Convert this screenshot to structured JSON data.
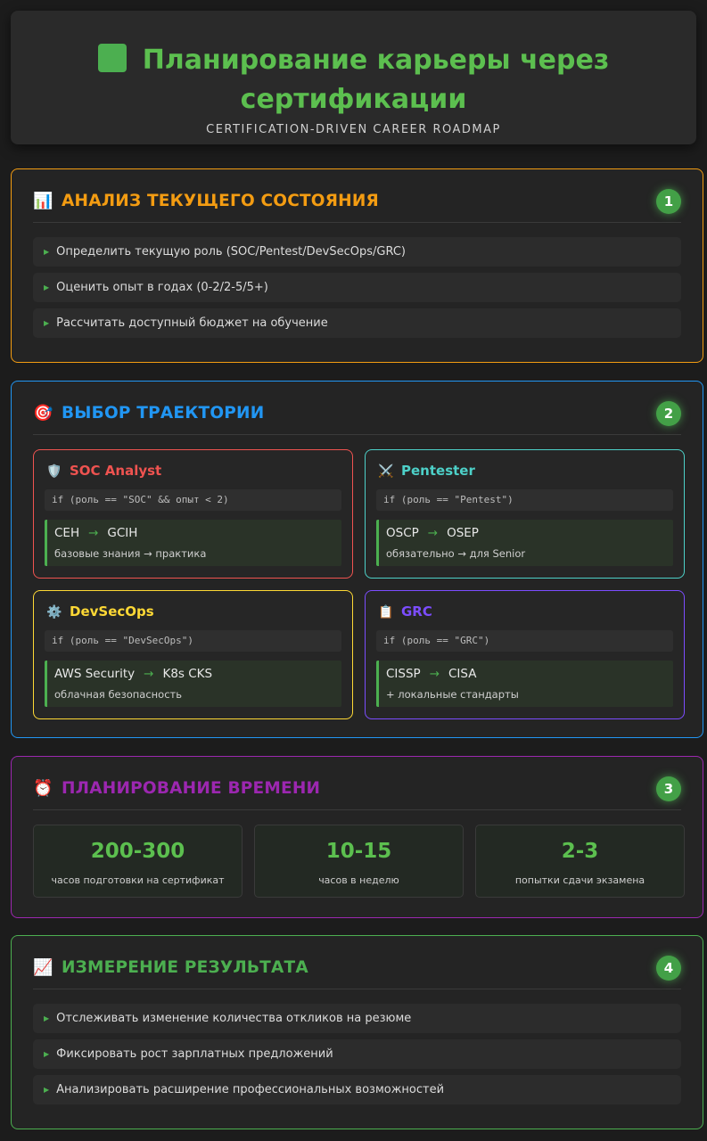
{
  "header": {
    "title_line1": "Планирование карьеры через",
    "title_line2": "сертификации",
    "subtitle": "CERTIFICATION-DRIVEN CAREER ROADMAP"
  },
  "colors": {
    "analysis": "#f39c12",
    "trajectory": "#2196f3",
    "time": "#9c27b0",
    "result": "#4caf50",
    "soc": "#ef5350",
    "pentester": "#4dd0c8",
    "devsecops": "#fdd835",
    "grc": "#7c4dff"
  },
  "sections": {
    "analysis": {
      "icon": "📊",
      "title": "АНАЛИЗ ТЕКУЩЕГО СОСТОЯНИЯ",
      "number": "1",
      "items": [
        "Определить текущую роль (SOC/Pentest/DevSecOps/GRC)",
        "Оценить опыт в годах (0-2/2-5/5+)",
        "Рассчитать доступный бюджет на обучение"
      ]
    },
    "trajectory": {
      "icon": "🎯",
      "title": "ВЫБОР ТРАЕКТОРИИ",
      "number": "2",
      "cards": [
        {
          "icon": "🛡️",
          "title": "SOC Analyst",
          "code": "if (роль == \"SOC\" && опыт < 2)",
          "from": "CEH",
          "to": "GCIH",
          "note": "базовые знания → практика"
        },
        {
          "icon": "⚔️",
          "title": "Pentester",
          "code": "if (роль == \"Pentest\")",
          "from": "OSCP",
          "to": "OSEP",
          "note": "обязательно → для Senior"
        },
        {
          "icon": "⚙️",
          "title": "DevSecOps",
          "code": "if (роль == \"DevSecOps\")",
          "from": "AWS Security",
          "to": "K8s CKS",
          "note": "облачная безопасность"
        },
        {
          "icon": "📋",
          "title": "GRC",
          "code": "if (роль == \"GRC\")",
          "from": "CISSP",
          "to": "CISA",
          "note": "+ локальные стандарты"
        }
      ]
    },
    "time": {
      "icon": "⏰",
      "title": "ПЛАНИРОВАНИЕ ВРЕМЕНИ",
      "number": "3",
      "stats": [
        {
          "value": "200-300",
          "label": "часов подготовки на сертификат"
        },
        {
          "value": "10-15",
          "label": "часов в неделю"
        },
        {
          "value": "2-3",
          "label": "попытки сдачи экзамена"
        }
      ]
    },
    "result": {
      "icon": "📈",
      "title": "ИЗМЕРЕНИЕ РЕЗУЛЬТАТА",
      "number": "4",
      "items": [
        "Отслеживать изменение количества откликов на резюме",
        "Фиксировать рост зарплатных предложений",
        "Анализировать расширение профессиональных возможностей"
      ]
    }
  }
}
